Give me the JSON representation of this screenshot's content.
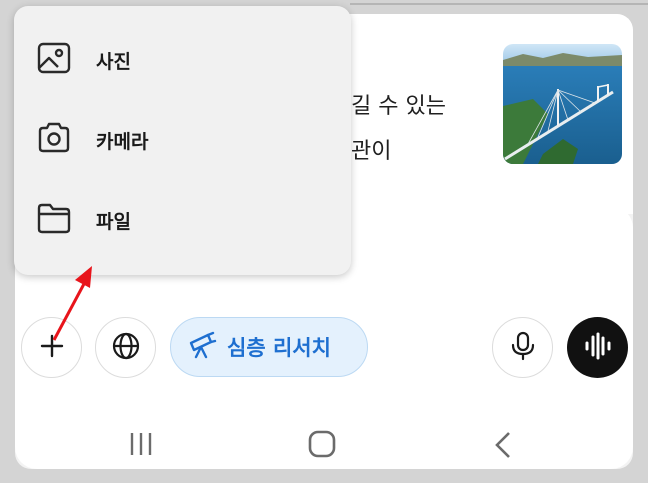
{
  "background_text": {
    "line1": "길 수 있는",
    "line2": "관이"
  },
  "thumbnail": {
    "alt": "bridge-photo"
  },
  "attach_menu": {
    "items": [
      {
        "label": "사진",
        "icon": "image-icon"
      },
      {
        "label": "카메라",
        "icon": "camera-icon"
      },
      {
        "label": "파일",
        "icon": "folder-icon"
      }
    ]
  },
  "toolbar": {
    "add_icon": "plus-icon",
    "web_icon": "globe-icon",
    "deep_research_label": "심층 리서치",
    "deep_research_icon": "telescope-icon",
    "mic_icon": "microphone-icon",
    "voice_icon": "voice-waveform-icon"
  },
  "navbar": {
    "recents_icon": "recents-icon",
    "home_icon": "home-icon",
    "back_icon": "back-icon"
  },
  "colors": {
    "accent": "#1e6fd0",
    "pill_bg": "#e4f1fd",
    "annotation_arrow": "#e8141b",
    "voice_button": "#111111"
  }
}
